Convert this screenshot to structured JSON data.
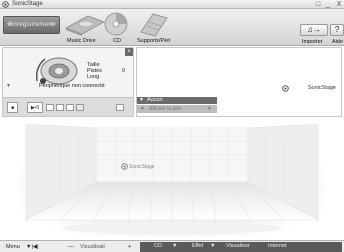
{
  "window": {
    "title": "SonicStage",
    "minimize": "_",
    "maximize": "□",
    "close": "X"
  },
  "toolbar": {
    "transfer_label": "Enregistrement",
    "sources": [
      {
        "label": "Music Drive",
        "icon": "music-drive-icon"
      },
      {
        "label": "CD",
        "icon": "cd-icon"
      },
      {
        "label": "Supports/Pérl",
        "icon": "portable-device-icon"
      }
    ],
    "import_label": "Importer",
    "help_label": "Aide"
  },
  "device_panel": {
    "status": "Périphérique non connecté",
    "fields": [
      "Taille",
      "Pistes",
      "Long"
    ],
    "track_count": "0",
    "play_glyph": "■",
    "skip_glyph": "▶•II"
  },
  "library_panel": {
    "title": "Aucun",
    "filter_placeholder": "Afficher la liste",
    "logo": "SonicStage"
  },
  "stage": {
    "logo": "SonicStage"
  },
  "bottom_bar": {
    "menu_label": "Menu",
    "volume_minus": "—",
    "volume_label": "Visualisati",
    "volume_plus": "+",
    "cd_label": "CD",
    "effect_label": "Effet",
    "visualize_label": "Visualiser",
    "internet_label": "Internet"
  },
  "colors": {
    "panel_dark": "#5a5a5a",
    "toolbar_light": "#f0f0f0",
    "background": "#ffffff"
  }
}
